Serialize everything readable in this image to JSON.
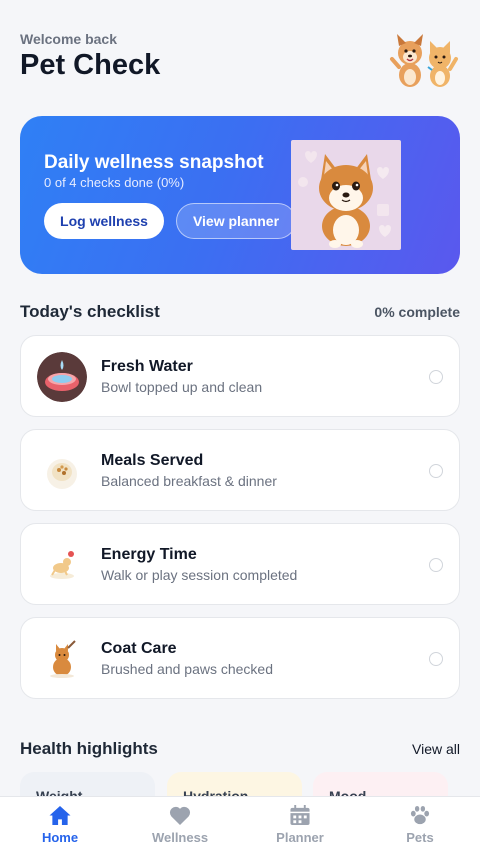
{
  "header": {
    "welcome": "Welcome back",
    "title": "Pet Check"
  },
  "hero": {
    "title": "Daily wellness snapshot",
    "subtitle": "0 of 4 checks done (0%)",
    "log_button": "Log wellness",
    "planner_button": "View planner"
  },
  "checklist": {
    "title": "Today's checklist",
    "progress": "0% complete",
    "items": [
      {
        "title": "Fresh Water",
        "subtitle": "Bowl topped up and clean",
        "icon": "water-bowl-icon",
        "done": false
      },
      {
        "title": "Meals Served",
        "subtitle": "Balanced breakfast & dinner",
        "icon": "food-bowl-icon",
        "done": false
      },
      {
        "title": "Energy Time",
        "subtitle": "Walk or play session completed",
        "icon": "play-dog-icon",
        "done": false
      },
      {
        "title": "Coat Care",
        "subtitle": "Brushed and paws checked",
        "icon": "grooming-cat-icon",
        "done": false
      }
    ]
  },
  "highlights": {
    "title": "Health highlights",
    "view_all": "View all",
    "cards": [
      {
        "label": "Weight"
      },
      {
        "label": "Hydration"
      },
      {
        "label": "Mood"
      }
    ]
  },
  "tabs": [
    {
      "label": "Home",
      "icon": "home-icon",
      "active": true
    },
    {
      "label": "Wellness",
      "icon": "heart-icon",
      "active": false
    },
    {
      "label": "Planner",
      "icon": "calendar-icon",
      "active": false
    },
    {
      "label": "Pets",
      "icon": "paw-icon",
      "active": false
    }
  ],
  "colors": {
    "accent": "#2563eb",
    "hero_start": "#2f80f5",
    "hero_end": "#5a58ee",
    "inactive_tab": "#9ca3af"
  }
}
